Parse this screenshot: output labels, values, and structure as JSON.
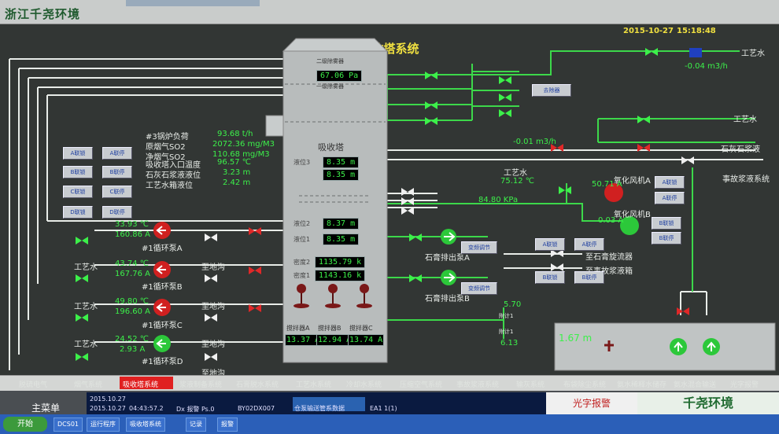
{
  "brand": "浙江千尧环境",
  "title": "吸收塔系统",
  "date": "2015-10-27",
  "time": "15:18:48",
  "top_readouts": [
    {
      "label": "#3锅炉负荷",
      "value": "93.68 t/h"
    },
    {
      "label": "原烟气SO2",
      "value": "2072.36 mg/M3"
    },
    {
      "label": "净烟气SO2",
      "value": "110.68 mg/M3"
    },
    {
      "label": "吸收塔入口温度",
      "value": "96.57 ℃"
    },
    {
      "label": "石灰石浆液液位",
      "value": "3.23 m"
    },
    {
      "label": "工艺水箱液位",
      "value": "2.42 m"
    }
  ],
  "tower": {
    "top_label_1": "二级除雾器",
    "pressure": "67.06 Pa",
    "top_label_2": "一级除雾器",
    "name": "吸收塔",
    "level3_label": "液位3",
    "level3_a": "8.35 m",
    "level3_b": "8.35 m",
    "level2_label": "液位2",
    "level2": "8.37 m",
    "level1_label": "液位1",
    "level1": "8.35 m",
    "density2_label": "密度2",
    "density2": "1135.79 k",
    "density1_label": "密度1",
    "density1": "1143.16 k",
    "agitators": [
      {
        "label": "搅拌器A",
        "value": "13.37 A"
      },
      {
        "label": "搅拌器B",
        "value": "12.94 A"
      },
      {
        "label": "搅拌器C",
        "value": "13.74 A"
      }
    ]
  },
  "pumps": [
    {
      "temp": "33.93 ℃",
      "current": "160.86 A",
      "name": "#1循环泵A",
      "left": "工艺水",
      "right": "至地沟"
    },
    {
      "temp": "43.74 ℃",
      "current": "167.76 A",
      "name": "#1循环泵B",
      "left": "工艺水",
      "right": "至地沟"
    },
    {
      "temp": "49.80 ℃",
      "current": "196.60 A",
      "name": "#1循环泵C",
      "left": "工艺水",
      "right": "至地沟"
    },
    {
      "temp": "24.52 ℃",
      "current": "2.93 A",
      "name": "#1循环泵D",
      "left": "工艺水",
      "right": "至地沟"
    }
  ],
  "small_buttons": [
    "A联锁",
    "A联停",
    "B联锁",
    "B联停",
    "C联锁",
    "C联停",
    "D联锁",
    "D联停"
  ],
  "right": {
    "top_flow": "-0.04 m3/h",
    "top_water": "工艺水",
    "btn1": "去除器",
    "water2": "工艺水",
    "flow2": "-0.01 m3/h",
    "limestone": "石灰石浆液",
    "accident": "事故浆液系统",
    "water3": "工艺水",
    "water3_temp": "75.12 ℃",
    "pressure": "84.80 KPa",
    "fan_a": "氧化风机A",
    "fan_a_val": "50.71 A",
    "fan_b": "氧化风机B",
    "fan_b_val": "0.03 A",
    "fan_btns": [
      "A联锁",
      "A联停",
      "B联锁",
      "B联停"
    ],
    "gypsum_a": "石膏排出泵A",
    "gypsum_b": "石膏排出泵B",
    "freq": "变频调节",
    "to_cyclone": "至石膏旋流器",
    "to_accident": "至事故浆液箱",
    "gyp_btns": [
      "A联锁",
      "A联停",
      "B联锁",
      "B联停"
    ],
    "meter_top": "5.70",
    "meter_bot": "6.13",
    "meter_lbl": "附计1",
    "level": "1.67 m"
  },
  "tabs": [
    "脱硫电气",
    "烟气系统",
    "吸收塔系统",
    "浆液制备系统",
    "石膏脱水系统",
    "工艺水系统",
    "冷却水系统",
    "压缩空气系统",
    "事故浆液系统",
    "输灰系统",
    "布袋除尘系统",
    "氨水稀释水储存",
    "氨水混合输送",
    "光字报警"
  ],
  "active_tab": "吸收塔系统",
  "bottom": {
    "main_menu": "主菜单",
    "event_date": "2015.10.27",
    "event_time": "04:43:57.2",
    "event_dev": "Dx 报警 Ps.0",
    "event_tag": "BY02DX007",
    "event_desc": "仓泵输送管系数据",
    "event_code": "EA1 1(1)",
    "alarm": "光字报警",
    "logo": "千尧环境"
  },
  "taskbar": {
    "start": "开始",
    "items": [
      "DCS01",
      "运行程序",
      "吸收塔系统",
      "记录",
      "报警"
    ]
  }
}
